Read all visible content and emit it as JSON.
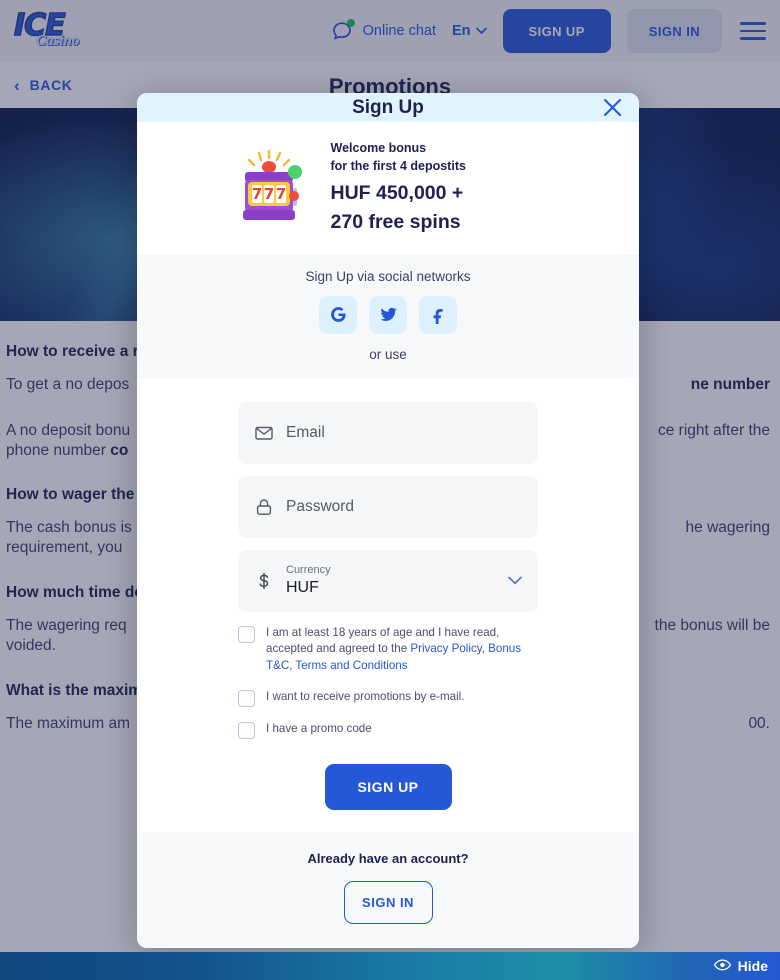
{
  "header": {
    "logo_primary": "ICE",
    "logo_secondary": "Casino",
    "chat_label": "Online chat",
    "lang_label": "En",
    "signup_label": "SIGN UP",
    "signin_label": "SIGN IN"
  },
  "page": {
    "back_label": "BACK",
    "title": "Promotions"
  },
  "faq": [
    {
      "q": "How to receive a reg",
      "a": "To get a no depos"
    },
    {
      "q": "",
      "a": "A no deposit bonu"
    },
    {
      "q": "How to wager the b",
      "a": "The cash bonus is"
    },
    {
      "q": "How much time do I",
      "a": "The wagering req"
    },
    {
      "q": "What is the maximu",
      "a": "The maximum am"
    }
  ],
  "faq_lines": {
    "l1_q": "How to receive a reg",
    "l1_q_tail": "",
    "l2_a": "To get a no depos",
    "l2_a_tail": "ne number",
    "l3_a1": "A no deposit bonu",
    "l3_a1_tail": "ce right after the",
    "l3_a2": "phone number ",
    "l3_a2_bold": "co",
    "l4_q": "How to wager the b",
    "l5_a1": "The cash bonus is",
    "l5_a1_tail": "he wagering",
    "l5_a2": "requirement, you",
    "l6_q": "How much time do I",
    "l7_a1": "The wagering req",
    "l7_a1_tail": "the bonus will be",
    "l7_a2": "voided.",
    "l8_q": "What is the maximu",
    "l9_a": "The maximum am",
    "l9_a_tail": "00."
  },
  "modal": {
    "title": "Sign Up",
    "close_icon": "close-icon",
    "bonus": {
      "icon": "slot-machine-icon",
      "line1": "Welcome bonus",
      "line2": "for the first 4 depostits",
      "amount_line1": "HUF 450,000  +",
      "amount_line2": "270 free spins"
    },
    "social": {
      "label": "Sign Up via social networks",
      "buttons": [
        {
          "name": "google-icon",
          "label": "G"
        },
        {
          "name": "twitter-icon",
          "label": ""
        },
        {
          "name": "facebook-icon",
          "label": "f"
        }
      ],
      "or_use": "or use"
    },
    "form": {
      "email_placeholder": "Email",
      "email_value": "",
      "password_placeholder": "Password",
      "password_value": "",
      "currency_label": "Currency",
      "currency_value": "HUF",
      "currency_options": [
        "HUF"
      ]
    },
    "checkboxes": {
      "age_text_1": "I am at least 18 years of age and I have read, accepted and agreed to the ",
      "age_link_privacy": "Privacy Policy",
      "age_sep_1": ", ",
      "age_link_bonus": "Bonus T&C",
      "age_sep_2": ", ",
      "age_link_terms": "Terms and Conditions",
      "promo_email": "I want to receive promotions by e-mail.",
      "promo_code": "I have a promo code"
    },
    "submit_label": "SIGN UP",
    "footer_question": "Already have an account?",
    "footer_signin_label": "SIGN IN"
  },
  "statusbar": {
    "hide_label": "Hide",
    "hide_icon": "eye-icon"
  },
  "colors": {
    "brand_blue": "#2458d6",
    "modal_header_bg": "#e1f4fd",
    "field_bg": "#f5f6f8",
    "text_dark": "#1d2150"
  }
}
